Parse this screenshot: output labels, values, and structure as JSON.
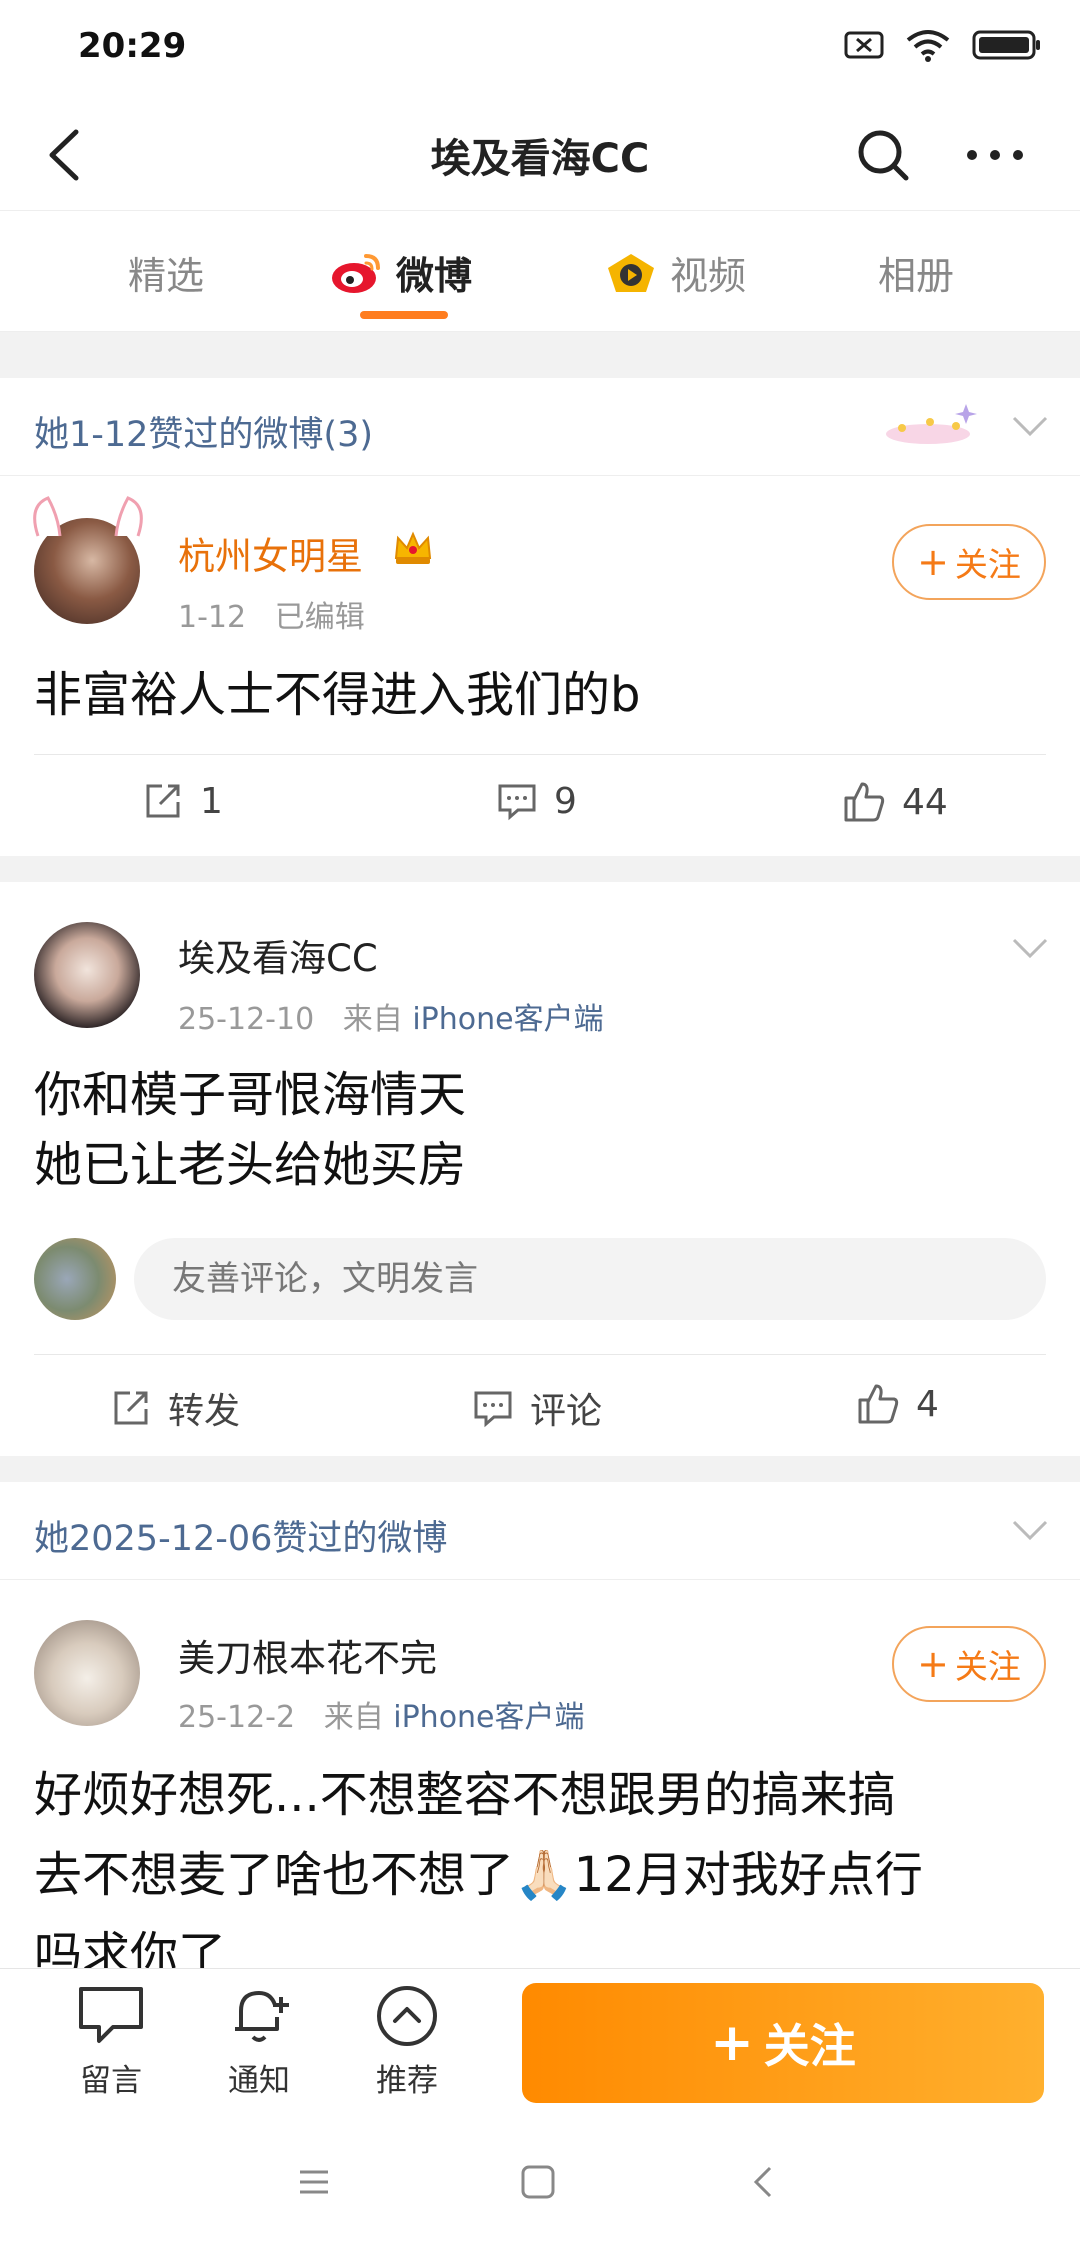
{
  "status_bar": {
    "time": "20:29"
  },
  "navbar": {
    "title": "埃及看海CC"
  },
  "tabs": [
    {
      "label": "精选"
    },
    {
      "label": "微博"
    },
    {
      "label": "视频"
    },
    {
      "label": "相册"
    }
  ],
  "sections": [
    {
      "label": "她1-12赞过的微博(3)"
    },
    {
      "label": "她2025-12-06赞过的微博"
    }
  ],
  "posts": [
    {
      "user": "杭州女明星",
      "date": "1-12",
      "edited": "已编辑",
      "text": "非富裕人士不得进入我们的b",
      "follow_label": "关注",
      "repost_count": "1",
      "comment_count": "9",
      "like_count": "44"
    },
    {
      "user": "埃及看海CC",
      "date": "25-12-10",
      "from": "来自",
      "source": "iPhone客户端",
      "text_line1": "你和模子哥恨海情天",
      "text_line2": "她已让老头给她买房",
      "comment_placeholder": "友善评论，文明发言",
      "repost_label": "转发",
      "comment_label": "评论",
      "like_count": "4"
    },
    {
      "user": "美刀根本花不完",
      "date": "25-12-2",
      "from": "来自",
      "source": "iPhone客户端",
      "text_line1": "好烦好想死...不想整容不想跟男的搞来搞",
      "text_line2": "去不想麦了啥也不想了🙏🏻12月对我好点行",
      "text_line3": "吗求你了",
      "follow_label": "关注"
    }
  ],
  "bottom_bar": {
    "message_label": "留言",
    "notify_label": "通知",
    "recommend_label": "推荐",
    "follow_label": "关注"
  },
  "colors": {
    "accent": "#ff7d1f",
    "link": "#4d6a92",
    "vip_name": "#e8710a"
  }
}
